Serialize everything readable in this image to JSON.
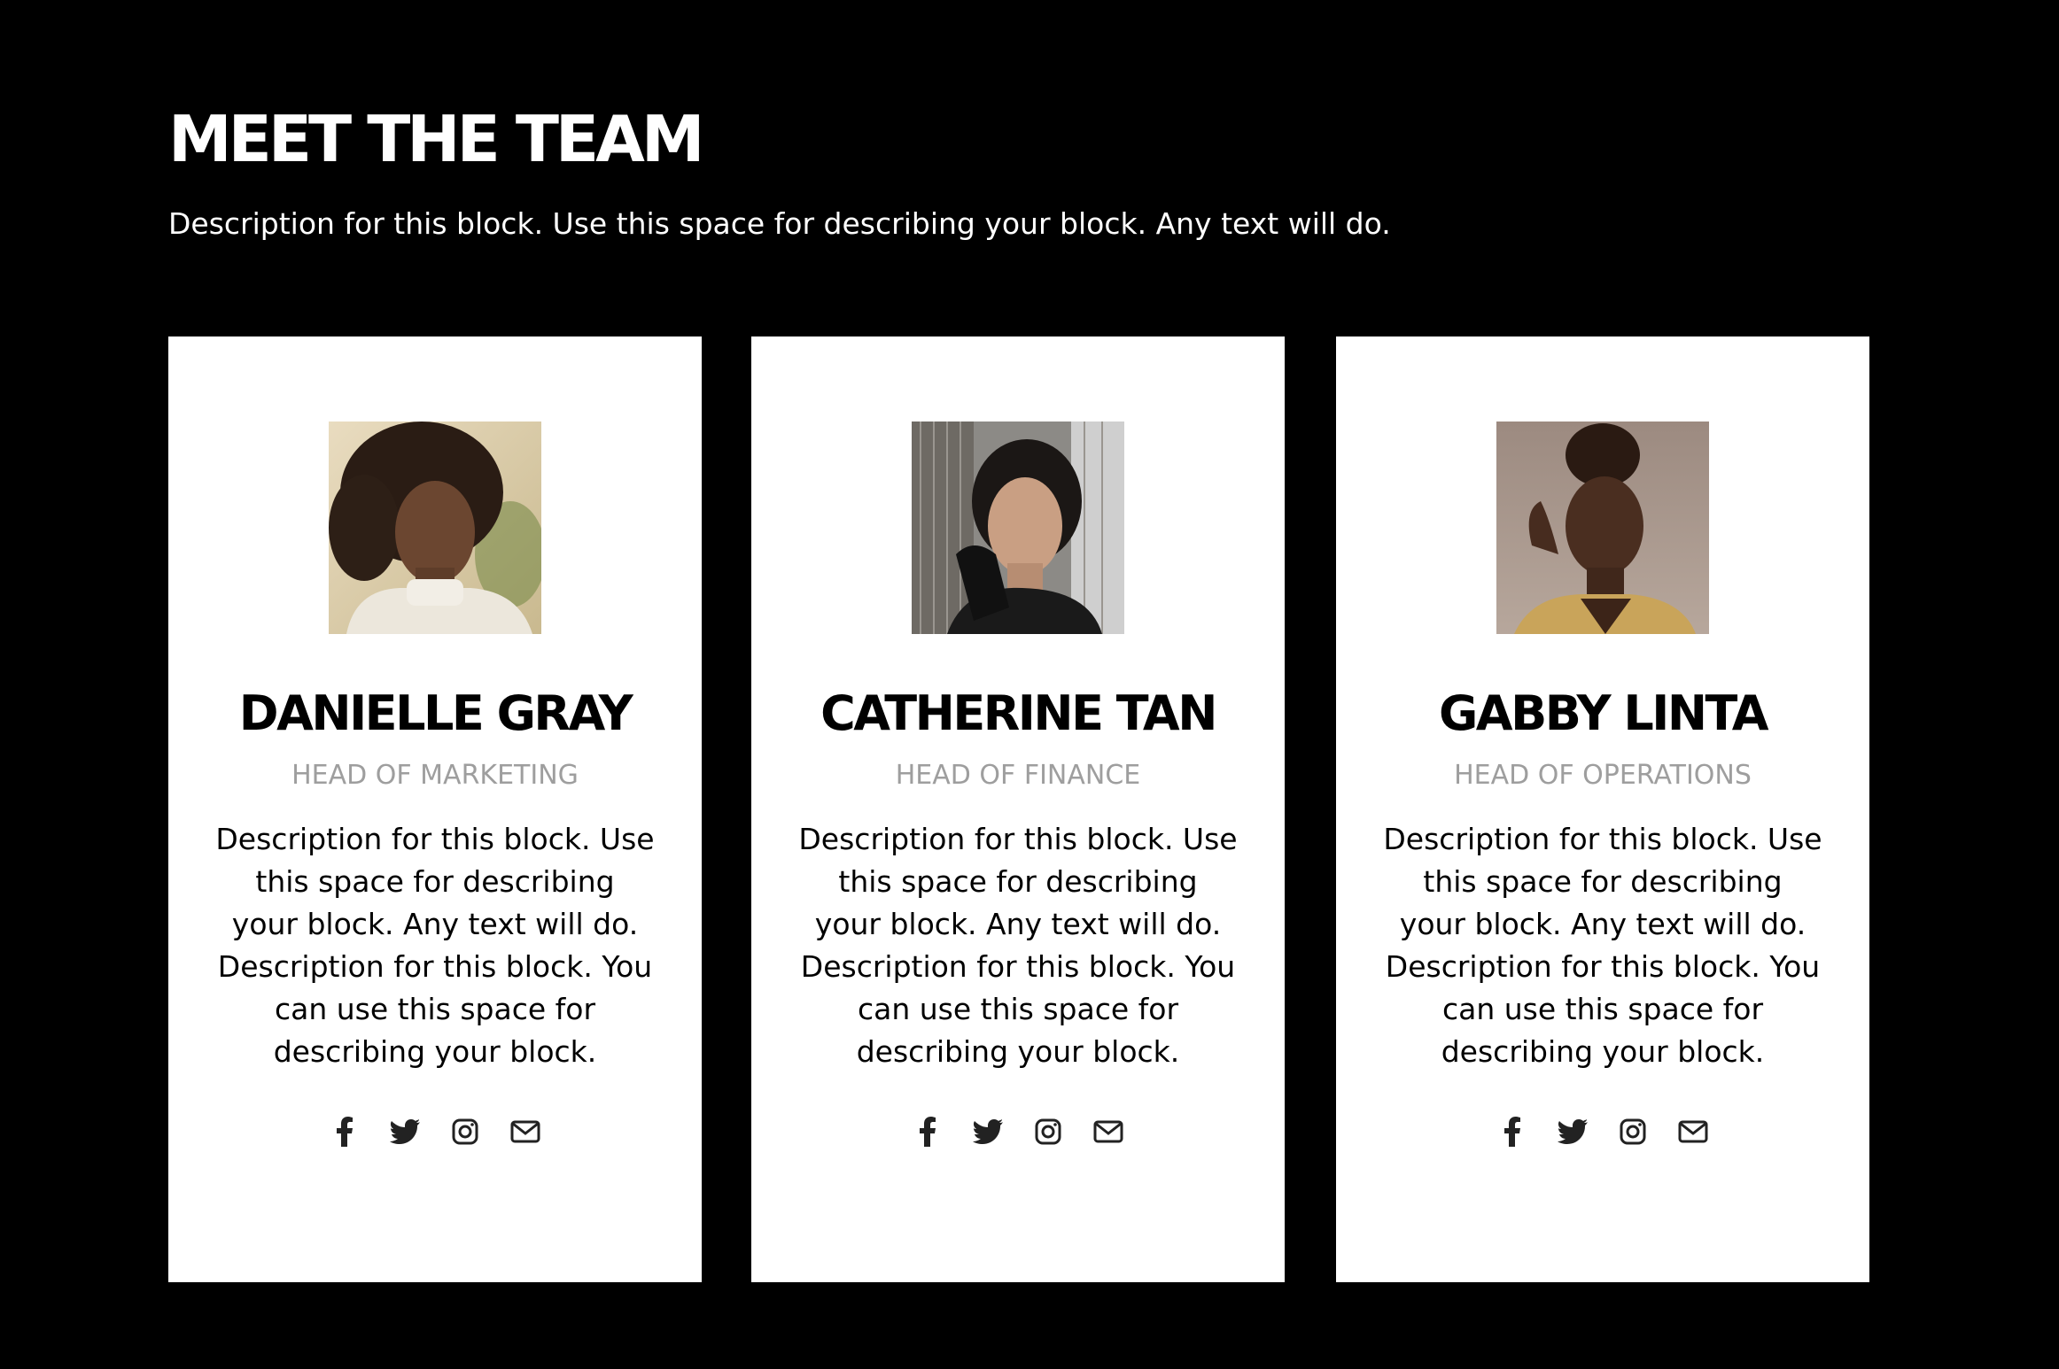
{
  "section": {
    "title": "MEET THE TEAM",
    "description": "Description for this block. Use this space for describing your block. Any text will do."
  },
  "members": [
    {
      "name": "DANIELLE GRAY",
      "role": "HEAD OF MARKETING",
      "bio_lines": [
        "Description for this block. Use",
        "this space for describing",
        "your block. Any text will do.",
        "Description for this block. You",
        "can use this space for",
        "describing your block."
      ]
    },
    {
      "name": "CATHERINE TAN",
      "role": "HEAD OF FINANCE",
      "bio_lines": [
        "Description for this block. Use",
        "this space for describing",
        "your block. Any text will do.",
        "Description for this block. You",
        "can use this space for",
        "describing your block."
      ]
    },
    {
      "name": "GABBY LINTA",
      "role": "HEAD OF OPERATIONS",
      "bio_lines": [
        "Description for this block. Use",
        "this space for describing",
        "your block. Any text will do.",
        "Description for this block. You",
        "can use this space for",
        "describing your block."
      ]
    }
  ],
  "social_icons": [
    "facebook-icon",
    "twitter-icon",
    "instagram-icon",
    "email-icon"
  ],
  "colors": {
    "background": "#000000",
    "card": "#ffffff",
    "role_text": "#9e9e9e",
    "icon": "#222222"
  }
}
